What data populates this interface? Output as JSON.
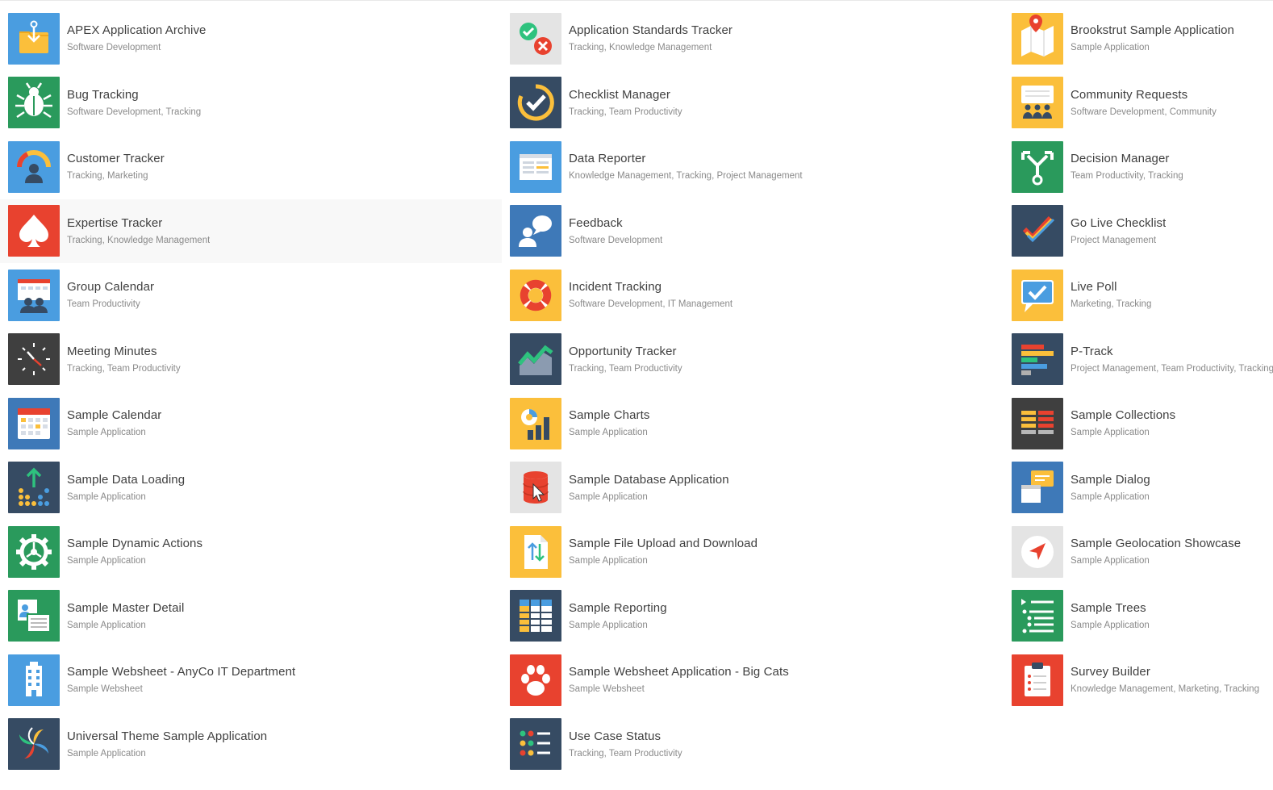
{
  "colors": {
    "blue": "#4a9de0",
    "green": "#2a9a5c",
    "red": "#e8422f",
    "yellow": "#fbbf3b",
    "navy": "#364b63",
    "darkgray": "#3f3f3f",
    "lightgray": "#e4e4e4",
    "steel": "#3e79b8"
  },
  "apps": [
    {
      "title": "APEX Application Archive",
      "categories": "Software Development",
      "icon": "archive-icon",
      "color": "blue"
    },
    {
      "title": "Bug Tracking",
      "categories": "Software Development, Tracking",
      "icon": "bug-icon",
      "color": "green"
    },
    {
      "title": "Customer Tracker",
      "categories": "Tracking, Marketing",
      "icon": "customer-gauge-icon",
      "color": "blue"
    },
    {
      "title": "Expertise Tracker",
      "categories": "Tracking, Knowledge Management",
      "icon": "spade-icon",
      "color": "red"
    },
    {
      "title": "Group Calendar",
      "categories": "Team Productivity",
      "icon": "group-calendar-icon",
      "color": "blue"
    },
    {
      "title": "Meeting Minutes",
      "categories": "Tracking, Team Productivity",
      "icon": "clock-icon",
      "color": "darkgray"
    },
    {
      "title": "Sample Calendar",
      "categories": "Sample Application",
      "icon": "calendar-icon",
      "color": "steel"
    },
    {
      "title": "Sample Data Loading",
      "categories": "Sample Application",
      "icon": "data-loading-icon",
      "color": "navy"
    },
    {
      "title": "Sample Dynamic Actions",
      "categories": "Sample Application",
      "icon": "gear-icon",
      "color": "green"
    },
    {
      "title": "Sample Master Detail",
      "categories": "Sample Application",
      "icon": "master-detail-icon",
      "color": "green"
    },
    {
      "title": "Sample Websheet - AnyCo IT Department",
      "categories": "Sample Websheet",
      "icon": "building-icon",
      "color": "blue"
    },
    {
      "title": "Universal Theme Sample Application",
      "categories": "Sample Application",
      "icon": "pinwheel-icon",
      "color": "navy"
    },
    {
      "title": "Application Standards Tracker",
      "categories": "Tracking, Knowledge Management",
      "icon": "check-cross-icon",
      "color": "lightgray"
    },
    {
      "title": "Checklist Manager",
      "categories": "Tracking, Team Productivity",
      "icon": "checklist-circle-icon",
      "color": "navy"
    },
    {
      "title": "Data Reporter",
      "categories": "Knowledge Management, Tracking, Project Management",
      "icon": "report-icon",
      "color": "blue"
    },
    {
      "title": "Feedback",
      "categories": "Software Development",
      "icon": "feedback-icon",
      "color": "steel"
    },
    {
      "title": "Incident Tracking",
      "categories": "Software Development, IT Management",
      "icon": "lifebuoy-icon",
      "color": "yellow"
    },
    {
      "title": "Opportunity Tracker",
      "categories": "Tracking, Team Productivity",
      "icon": "trend-icon",
      "color": "navy"
    },
    {
      "title": "Sample Charts",
      "categories": "Sample Application",
      "icon": "charts-icon",
      "color": "yellow"
    },
    {
      "title": "Sample Database Application",
      "categories": "Sample Application",
      "icon": "database-icon",
      "color": "lightgray"
    },
    {
      "title": "Sample File Upload and Download",
      "categories": "Sample Application",
      "icon": "file-transfer-icon",
      "color": "yellow"
    },
    {
      "title": "Sample Reporting",
      "categories": "Sample Application",
      "icon": "table-icon",
      "color": "navy"
    },
    {
      "title": "Sample Websheet Application - Big Cats",
      "categories": "Sample Websheet",
      "icon": "paw-icon",
      "color": "red"
    },
    {
      "title": "Use Case Status",
      "categories": "Tracking, Team Productivity",
      "icon": "status-list-icon",
      "color": "navy"
    },
    {
      "title": "Brookstrut Sample Application",
      "categories": "Sample Application",
      "icon": "map-pin-icon",
      "color": "yellow"
    },
    {
      "title": "Community Requests",
      "categories": "Software Development, Community",
      "icon": "community-icon",
      "color": "yellow"
    },
    {
      "title": "Decision Manager",
      "categories": "Team Productivity, Tracking",
      "icon": "decision-icon",
      "color": "green"
    },
    {
      "title": "Go Live Checklist",
      "categories": "Project Management",
      "icon": "golive-check-icon",
      "color": "navy"
    },
    {
      "title": "Live Poll",
      "categories": "Marketing, Tracking",
      "icon": "poll-icon",
      "color": "yellow"
    },
    {
      "title": "P-Track",
      "categories": "Project Management, Team Productivity, Tracking",
      "icon": "ptrack-bars-icon",
      "color": "navy"
    },
    {
      "title": "Sample Collections",
      "categories": "Sample Application",
      "icon": "collections-icon",
      "color": "darkgray"
    },
    {
      "title": "Sample Dialog",
      "categories": "Sample Application",
      "icon": "dialog-icon",
      "color": "steel"
    },
    {
      "title": "Sample Geolocation Showcase",
      "categories": "Sample Application",
      "icon": "navigation-icon",
      "color": "lightgray"
    },
    {
      "title": "Sample Trees",
      "categories": "Sample Application",
      "icon": "tree-list-icon",
      "color": "green"
    },
    {
      "title": "Survey Builder",
      "categories": "Knowledge Management, Marketing, Tracking",
      "icon": "clipboard-icon",
      "color": "red"
    }
  ]
}
